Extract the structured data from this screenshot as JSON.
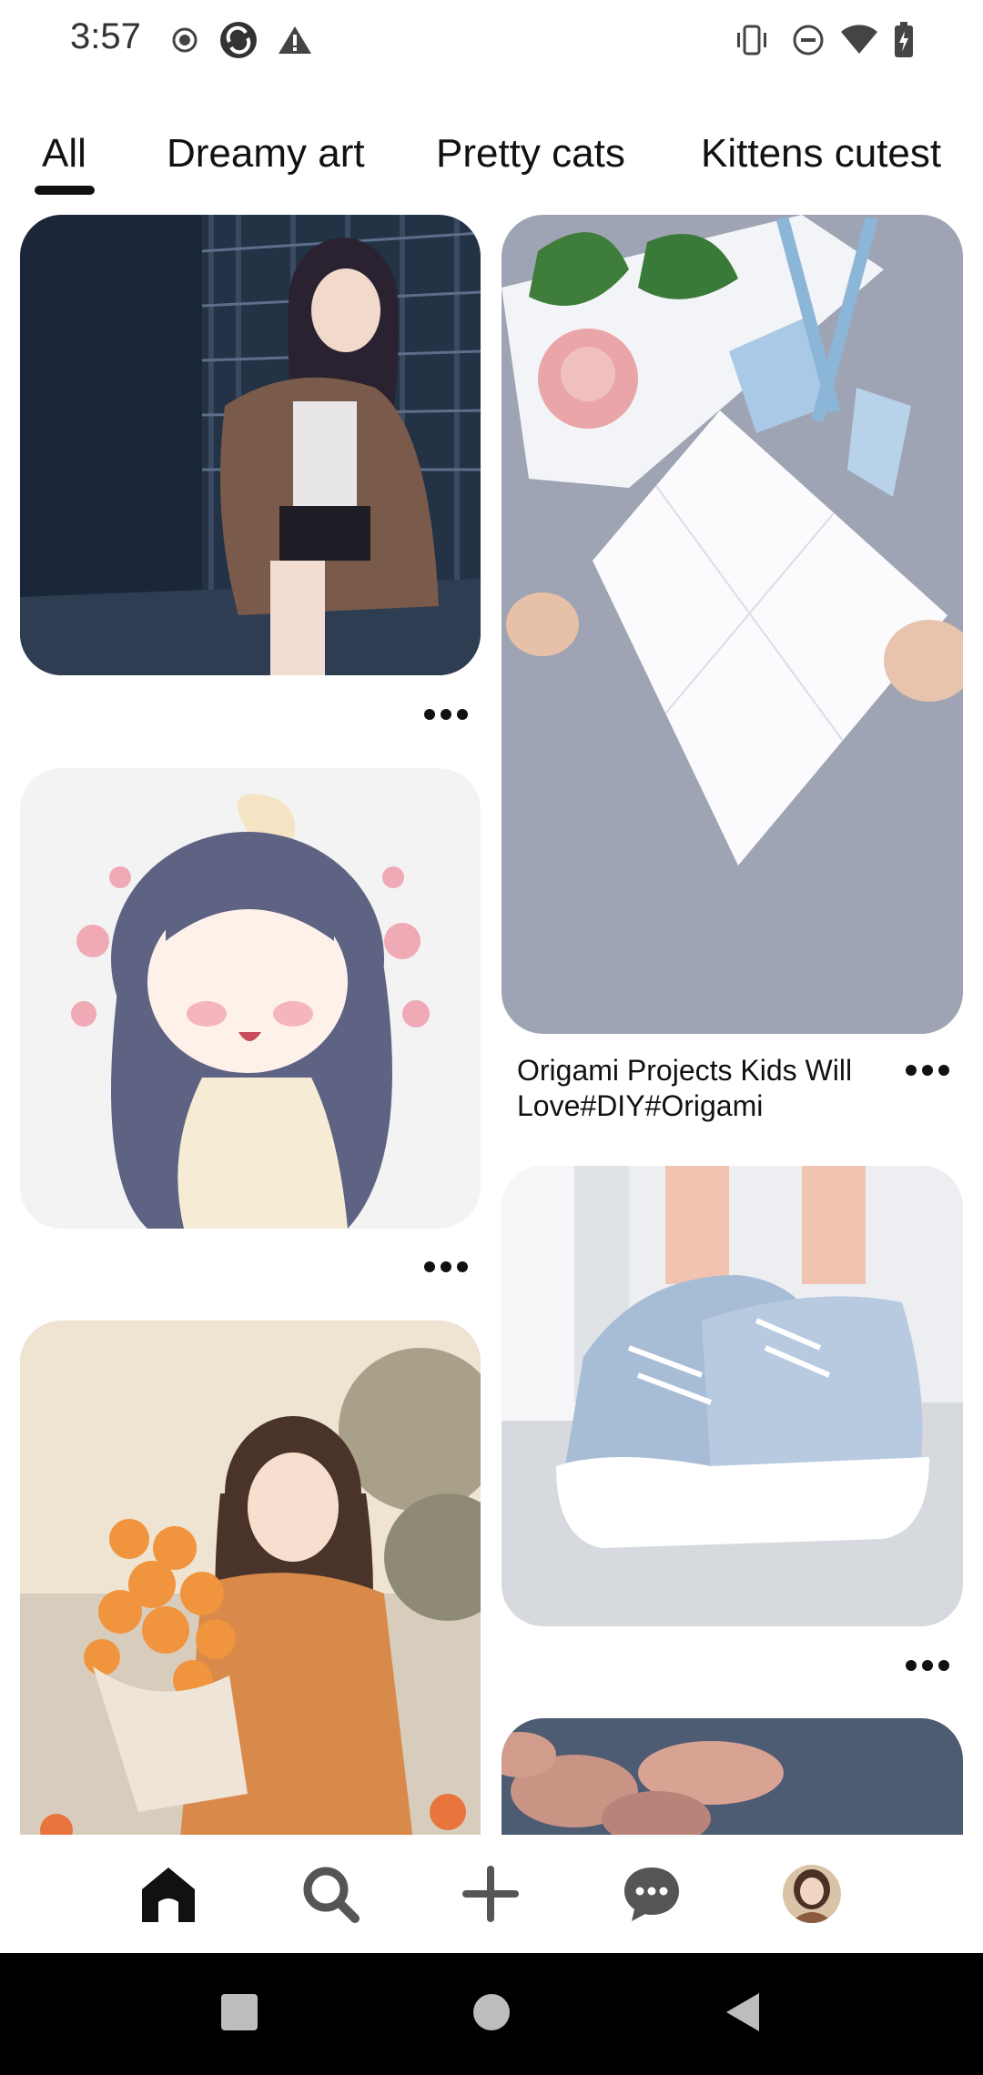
{
  "status_bar": {
    "time": "3:57",
    "left_icons": [
      "record-icon",
      "app-sync-icon",
      "warning-icon"
    ],
    "right_icons": [
      "vibrate-icon",
      "do-not-disturb-icon",
      "wifi-icon",
      "battery-icon"
    ]
  },
  "tabs": [
    {
      "label": "All",
      "selected": true
    },
    {
      "label": "Dreamy art",
      "selected": false
    },
    {
      "label": "Pretty cats",
      "selected": false
    },
    {
      "label": "Kittens cutest",
      "selected": false
    }
  ],
  "pins": [
    {
      "id": "anime-girl-street",
      "image": "Anime girl in jacket leaning on shutter wall at night",
      "caption": ""
    },
    {
      "id": "origami-projects",
      "image": "Hands folding white paper with origami rose and scoops",
      "caption_lines": [
        "Origami Projects Kids Will",
        "Love#DIY#Origami"
      ]
    },
    {
      "id": "chibi-girl-bow",
      "image": "Smiling chibi girl with bow and flowers",
      "caption": ""
    },
    {
      "id": "sneakers",
      "image": "Light blue and white high-top platform sneakers",
      "caption": ""
    },
    {
      "id": "girl-with-flowers",
      "image": "Girl holding orange rose bouquet",
      "caption": ""
    },
    {
      "id": "sky-clouds",
      "image": "Sky with pink clouds",
      "caption": ""
    }
  ],
  "bottom_nav": {
    "items": [
      "home-icon",
      "search-icon",
      "create-icon",
      "messages-icon",
      "profile-avatar"
    ],
    "selected": "home-icon"
  },
  "system_nav": [
    "recents-button",
    "home-button",
    "back-button"
  ],
  "colors": {
    "text": "#111111",
    "background": "#ffffff",
    "system_nav": "#000000"
  }
}
